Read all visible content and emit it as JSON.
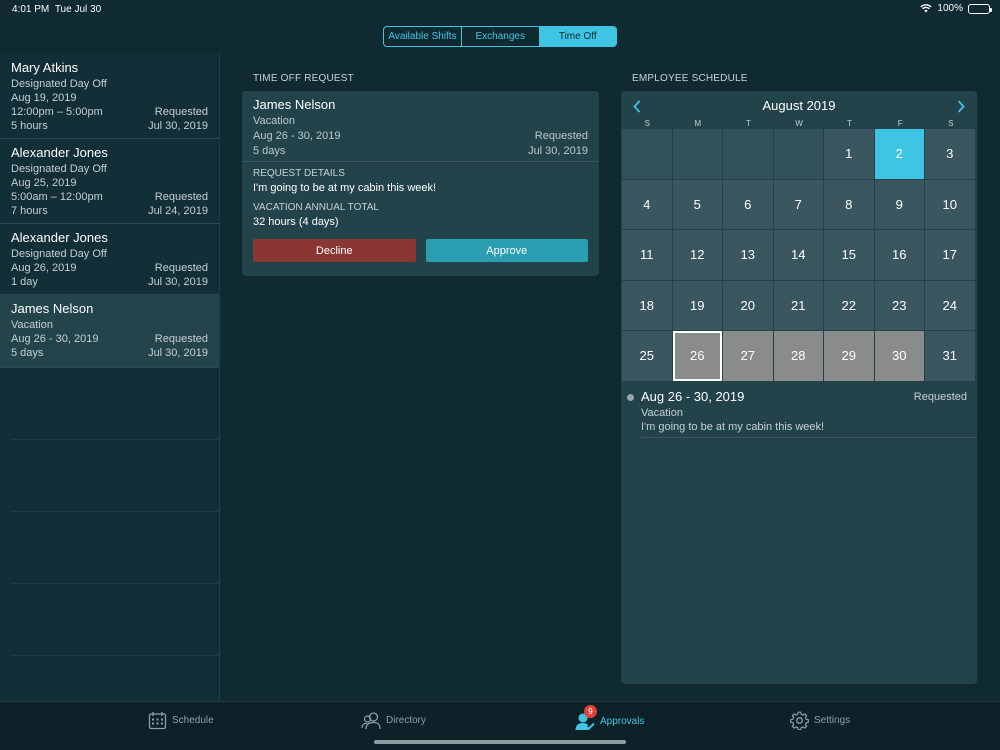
{
  "status_bar": {
    "time": "4:01 PM",
    "date": "Tue Jul 30",
    "battery": "100%"
  },
  "segments": [
    {
      "label": "Available Shifts",
      "active": false
    },
    {
      "label": "Exchanges",
      "active": false
    },
    {
      "label": "Time Off",
      "active": true
    }
  ],
  "requests": [
    {
      "name": "Mary Atkins",
      "type": "Designated Day Off",
      "date": "Aug 19, 2019",
      "time": "12:00pm – 5:00pm",
      "status": "Requested",
      "duration": "5 hours",
      "submitted": "Jul 30, 2019"
    },
    {
      "name": "Alexander Jones",
      "type": "Designated Day Off",
      "date": "Aug 25, 2019",
      "time": "5:00am – 12:00pm",
      "status": "Requested",
      "duration": "7 hours",
      "submitted": "Jul 24, 2019"
    },
    {
      "name": "Alexander Jones",
      "type": "Designated Day Off",
      "date": "Aug 26, 2019",
      "status": "Requested",
      "duration": "1 day",
      "submitted": "Jul 30, 2019"
    },
    {
      "name": "James Nelson",
      "type": "Vacation",
      "date": "Aug 26 - 30, 2019",
      "status": "Requested",
      "duration": "5 days",
      "submitted": "Jul 30, 2019"
    }
  ],
  "detail": {
    "section_title": "TIME OFF REQUEST",
    "name": "James Nelson",
    "type": "Vacation",
    "dates": "Aug 26 - 30, 2019",
    "status": "Requested",
    "duration": "5 days",
    "submitted": "Jul 30, 2019",
    "details_label": "REQUEST DETAILS",
    "details_text": "I'm going to be at my cabin this week!",
    "total_label": "VACATION ANNUAL TOTAL",
    "total_value": "32 hours (4 days)",
    "decline_label": "Decline",
    "approve_label": "Approve"
  },
  "schedule": {
    "section_title": "EMPLOYEE SCHEDULE",
    "month": "August 2019",
    "weekdays": [
      "S",
      "M",
      "T",
      "W",
      "T",
      "F",
      "S"
    ],
    "leading_blanks": 4,
    "days_in_month": 31,
    "today": 2,
    "range_start": 26,
    "range_end": 30,
    "selected_day": 26,
    "event": {
      "dates": "Aug 26 - 30, 2019",
      "status": "Requested",
      "type": "Vacation",
      "note": "I'm going to be at my cabin this week!"
    }
  },
  "tabs": {
    "schedule": "Schedule",
    "directory": "Directory",
    "approvals": "Approvals",
    "approvals_badge": "9",
    "settings": "Settings"
  },
  "colors": {
    "accent": "#3fc4e3",
    "decline": "#8a3632",
    "approve": "#2a9db0",
    "badge": "#e0413a"
  }
}
